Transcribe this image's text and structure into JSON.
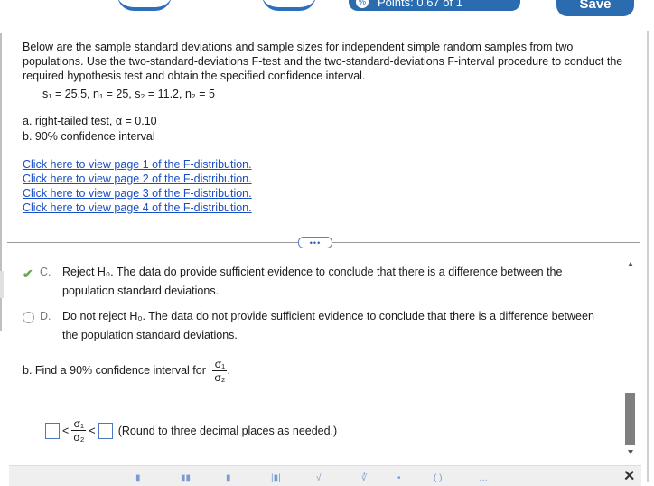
{
  "header": {
    "points_label": "Points: 0.67 of 1",
    "save_label": "Save"
  },
  "question": {
    "intro": "Below are the sample standard deviations and sample sizes for independent simple random samples from two populations. Use the two-standard-deviations F-test and the two-standard-deviations F-interval procedure to conduct the required hypothesis test and obtain the specified confidence interval.",
    "given": "s₁ = 25.5, n₁ = 25, s₂ = 11.2, n₂ = 5",
    "part_a": "a. right-tailed test, α = 0.10",
    "part_b": "b. 90% confidence interval"
  },
  "links": [
    "Click here to view page 1 of the F-distribution.",
    "Click here to view page 2 of the F-distribution.",
    "Click here to view page 3 of the F-distribution.",
    "Click here to view page 4 of the F-distribution."
  ],
  "more_button": "•••",
  "options": {
    "c": {
      "letter": "C.",
      "text": "Reject H₀. The data do provide sufficient evidence to conclude that there is a difference between the population standard deviations.",
      "state": "selected-correct"
    },
    "d": {
      "letter": "D.",
      "text": "Do not reject H₀. The data do not provide sufficient evidence to conclude that there is a difference between the population standard deviations.",
      "state": "unselected"
    }
  },
  "part_b_prompt": {
    "text": "b. Find a 90% confidence interval for",
    "frac_num": "σ₁",
    "frac_den": "σ₂",
    "period": "."
  },
  "ci_input": {
    "lt": "<",
    "frac_num": "σ₁",
    "frac_den": "σ₂",
    "note": "(Round to three decimal places as needed.)"
  },
  "bottom": {
    "close_label": "✕"
  },
  "colors": {
    "accent": "#2b6cb0",
    "link": "#1a4fc4",
    "check": "#6aa84f"
  }
}
